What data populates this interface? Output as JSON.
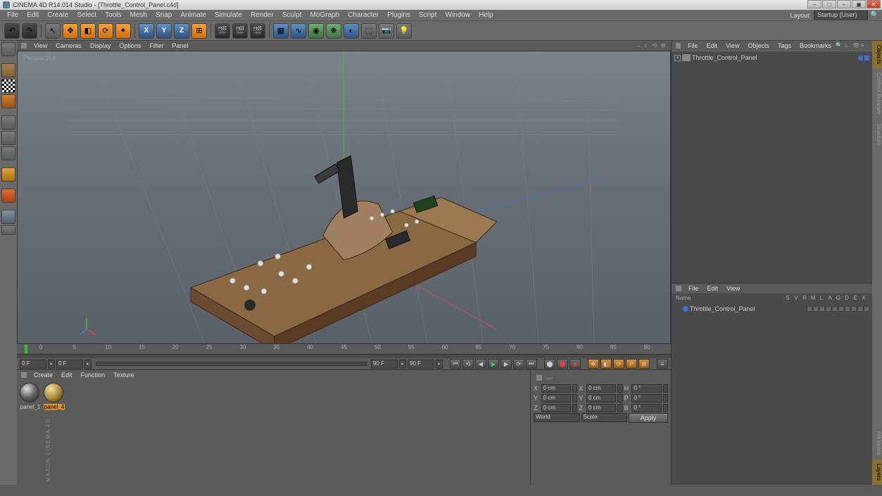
{
  "title": "CINEMA 4D R14.014 Studio - [Throttle_Control_Panel.c4d]",
  "menubar": [
    "File",
    "Edit",
    "Create",
    "Select",
    "Tools",
    "Mesh",
    "Snap",
    "Animate",
    "Simulate",
    "Render",
    "Sculpt",
    "MoGraph",
    "Character",
    "Plugins",
    "Script",
    "Window",
    "Help"
  ],
  "layout_label": "Layout:",
  "layout_value": "Startup (User)",
  "viewport_menus": [
    "View",
    "Cameras",
    "Display",
    "Options",
    "Filter",
    "Panel"
  ],
  "viewport_label": "Perspective",
  "timeline_marks": [
    "0",
    "5",
    "10",
    "15",
    "20",
    "25",
    "30",
    "35",
    "40",
    "45",
    "50",
    "55",
    "60",
    "65",
    "70",
    "75",
    "80",
    "85",
    "90"
  ],
  "frame_start": "0 F",
  "frame_end": "90 F",
  "frame_cur_a": "0 F",
  "frame_cur_b": "90 F",
  "material_menus": [
    "Create",
    "Edit",
    "Function",
    "Texture"
  ],
  "materials": [
    {
      "name": "panel_1",
      "selected": false
    },
    {
      "name": "panel_4",
      "selected": true
    }
  ],
  "coord": {
    "rows": [
      {
        "l1": "X",
        "v1": "0 cm",
        "l2": "X",
        "v2": "0 cm",
        "l3": "H",
        "v3": "0 °"
      },
      {
        "l1": "Y",
        "v1": "0 cm",
        "l2": "Y",
        "v2": "0 cm",
        "l3": "P",
        "v3": "0 °"
      },
      {
        "l1": "Z",
        "v1": "0 cm",
        "l2": "Z",
        "v2": "0 cm",
        "l3": "B",
        "v3": "0 °"
      }
    ],
    "system": "World",
    "mode": "Scale",
    "apply": "Apply"
  },
  "objmgr_menus": [
    "File",
    "Edit",
    "View",
    "Objects",
    "Tags",
    "Bookmarks"
  ],
  "obj_tree_item": "Throttle_Control_Panel",
  "attrmgr_menus": [
    "File",
    "Edit",
    "View"
  ],
  "attr_headers": [
    "Name",
    "S",
    "V",
    "R",
    "M",
    "L",
    "A",
    "G",
    "D",
    "E",
    "X"
  ],
  "attr_item": "Throttle_Control_Panel",
  "right_tabs": [
    "Objects",
    "Content Browser",
    "Structure"
  ],
  "right_tabs2": [
    "Attributes",
    "Layers"
  ],
  "maxon": "MAXON\nCINEMA 4D"
}
